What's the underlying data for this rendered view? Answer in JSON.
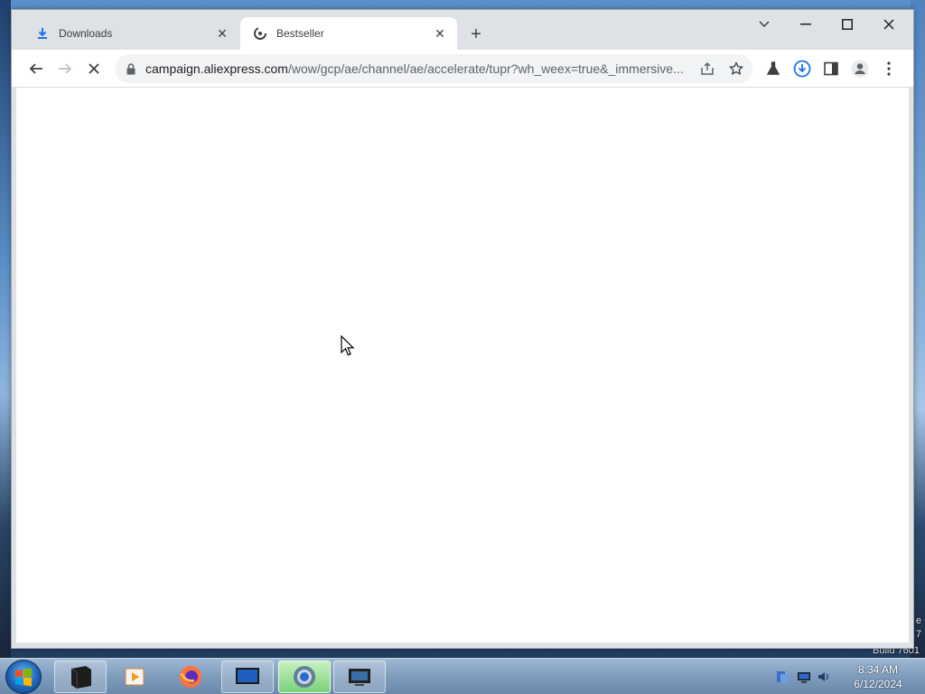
{
  "browser": {
    "tabs": [
      {
        "title": "Downloads",
        "icon": "download-icon",
        "active": false
      },
      {
        "title": "Bestseller",
        "icon": "aliexpress-favicon-icon",
        "active": true
      }
    ],
    "new_tab_label": "+",
    "address_bar": {
      "host": "campaign.aliexpress.com",
      "path": "/wow/gcp/ae/channel/ae/accelerate/tupr?wh_weex=true&_immersive..."
    },
    "page_loading": true
  },
  "desktop": {
    "watermark_lines": [
      "e",
      "7",
      "Build 7601"
    ]
  },
  "taskbar": {
    "apps": [
      "terminal-app",
      "media-player-app",
      "firefox-app",
      "monitor-app",
      "chrome-app",
      "remote-desktop-app"
    ],
    "clock": {
      "time": "8:34 AM",
      "date": "6/12/2024"
    }
  },
  "colors": {
    "accent": "#1a73e8",
    "tab_strip": "#dee1e6",
    "omnibox": "#f1f3f4"
  }
}
